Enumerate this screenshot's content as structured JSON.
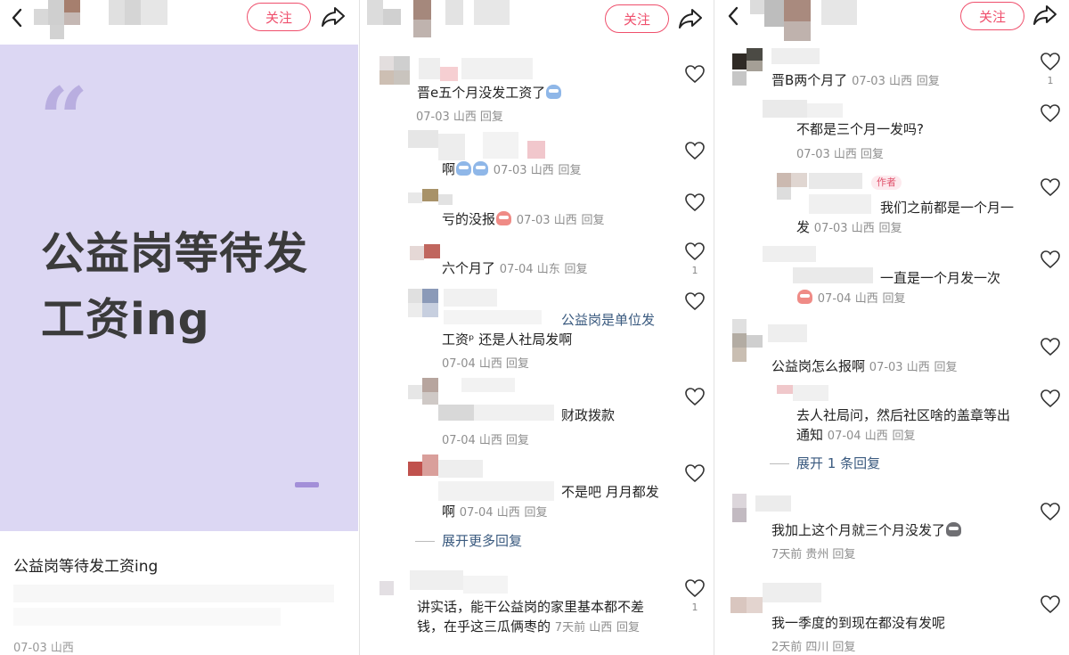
{
  "common": {
    "follow_label": "关注",
    "reply": "回复"
  },
  "panel1": {
    "cover_quote": "“",
    "cover_title": "公益岗等待发工资ing",
    "post_title": "公益岗等待发工资ing",
    "post_meta": "07-03 山西"
  },
  "panel2": {
    "comments": [
      {
        "text": "晋e五个月没发工资了",
        "meta": "07-03 山西"
      },
      {
        "text": "啊",
        "meta": "07-03 山西"
      },
      {
        "text": "亏的没报",
        "meta": "07-03 山西"
      },
      {
        "text": "六个月了",
        "meta": "07-04 山东",
        "likes": "1"
      },
      {
        "text_highlight": "公益岗是单位发",
        "text_line2": "工资ᵖ 还是人社局发啊",
        "meta": "07-04 山西"
      },
      {
        "text": "财政拨款",
        "meta": "07-04 山西"
      },
      {
        "text": "不是吧 月月都发",
        "text_line2": "啊",
        "meta": "07-04 山西"
      },
      {
        "text": "讲实话，能干公益岗的家里基本都不差",
        "text_line2": "钱，在乎这三瓜俩枣的",
        "meta": "7天前 山西",
        "likes": "1"
      }
    ],
    "expand_label": "展开更多回复"
  },
  "panel3": {
    "comments": [
      {
        "text": "晋B两个月了",
        "meta": "07-03 山西",
        "likes": "1"
      },
      {
        "text": "不都是三个月一发吗?",
        "meta": "07-03 山西"
      },
      {
        "badge": "作者",
        "text": "我们之前都是一个月一",
        "text_line2": "发",
        "meta": "07-03 山西"
      },
      {
        "text": "一直是一个月发一次",
        "meta": "07-04 山西"
      },
      {
        "text": "公益岗怎么报啊",
        "meta": "07-03 山西"
      },
      {
        "text": "去人社局问，然后社区啥的盖章等出",
        "text_line2": "通知",
        "meta": "07-04 山西"
      },
      {
        "text": "我加上这个月就三个月没发了",
        "meta": "7天前 贵州"
      },
      {
        "text": "我一季度的到现在都没有发呢",
        "meta": "2天前 四川"
      }
    ],
    "expand_label": "展开 1 条回复"
  },
  "colors": {
    "accent": "#ef4f6c",
    "cover_bg": "#dcd7f3",
    "link": "#3a5a7f",
    "meta": "#8e8e8e"
  },
  "icons": [
    "back-icon",
    "share-icon",
    "heart-icon",
    "quote-icon",
    "emoji-icon"
  ]
}
